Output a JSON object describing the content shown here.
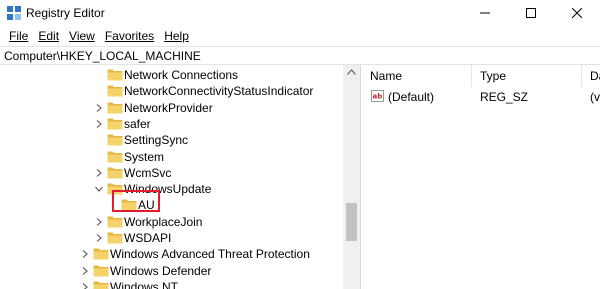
{
  "window": {
    "title": "Registry Editor",
    "icon": "registry-editor-icon"
  },
  "menu": [
    "File",
    "Edit",
    "View",
    "Favorites",
    "Help"
  ],
  "address": "Computer\\HKEY_LOCAL_MACHINE",
  "tree": {
    "nodes": [
      {
        "label": "Network Connections",
        "expand": "none",
        "level": 2
      },
      {
        "label": "NetworkConnectivityStatusIndicator",
        "expand": "none",
        "level": 2
      },
      {
        "label": "NetworkProvider",
        "expand": "collapsed",
        "level": 2
      },
      {
        "label": "safer",
        "expand": "collapsed",
        "level": 2
      },
      {
        "label": "SettingSync",
        "expand": "none",
        "level": 2
      },
      {
        "label": "System",
        "expand": "none",
        "level": 2
      },
      {
        "label": "WcmSvc",
        "expand": "collapsed",
        "level": 2
      },
      {
        "label": "WindowsUpdate",
        "expand": "expanded",
        "level": 2
      },
      {
        "label": "AU",
        "expand": "none",
        "level": 3,
        "highlighted": true
      },
      {
        "label": "WorkplaceJoin",
        "expand": "collapsed",
        "level": 2
      },
      {
        "label": "WSDAPI",
        "expand": "collapsed",
        "level": 2
      },
      {
        "label": "Windows Advanced Threat Protection",
        "expand": "collapsed",
        "level": 1
      },
      {
        "label": "Windows Defender",
        "expand": "collapsed",
        "level": 1
      },
      {
        "label": "Windows NT",
        "expand": "collapsed",
        "level": 1
      }
    ],
    "highlight_color": "#e11d2b",
    "folder_color": "#f5d36b"
  },
  "values_pane": {
    "columns": [
      "Name",
      "Type",
      "Da"
    ],
    "rows": [
      {
        "name": "(Default)",
        "type": "REG_SZ",
        "data": "(va",
        "icon": "string-value-icon"
      }
    ]
  }
}
